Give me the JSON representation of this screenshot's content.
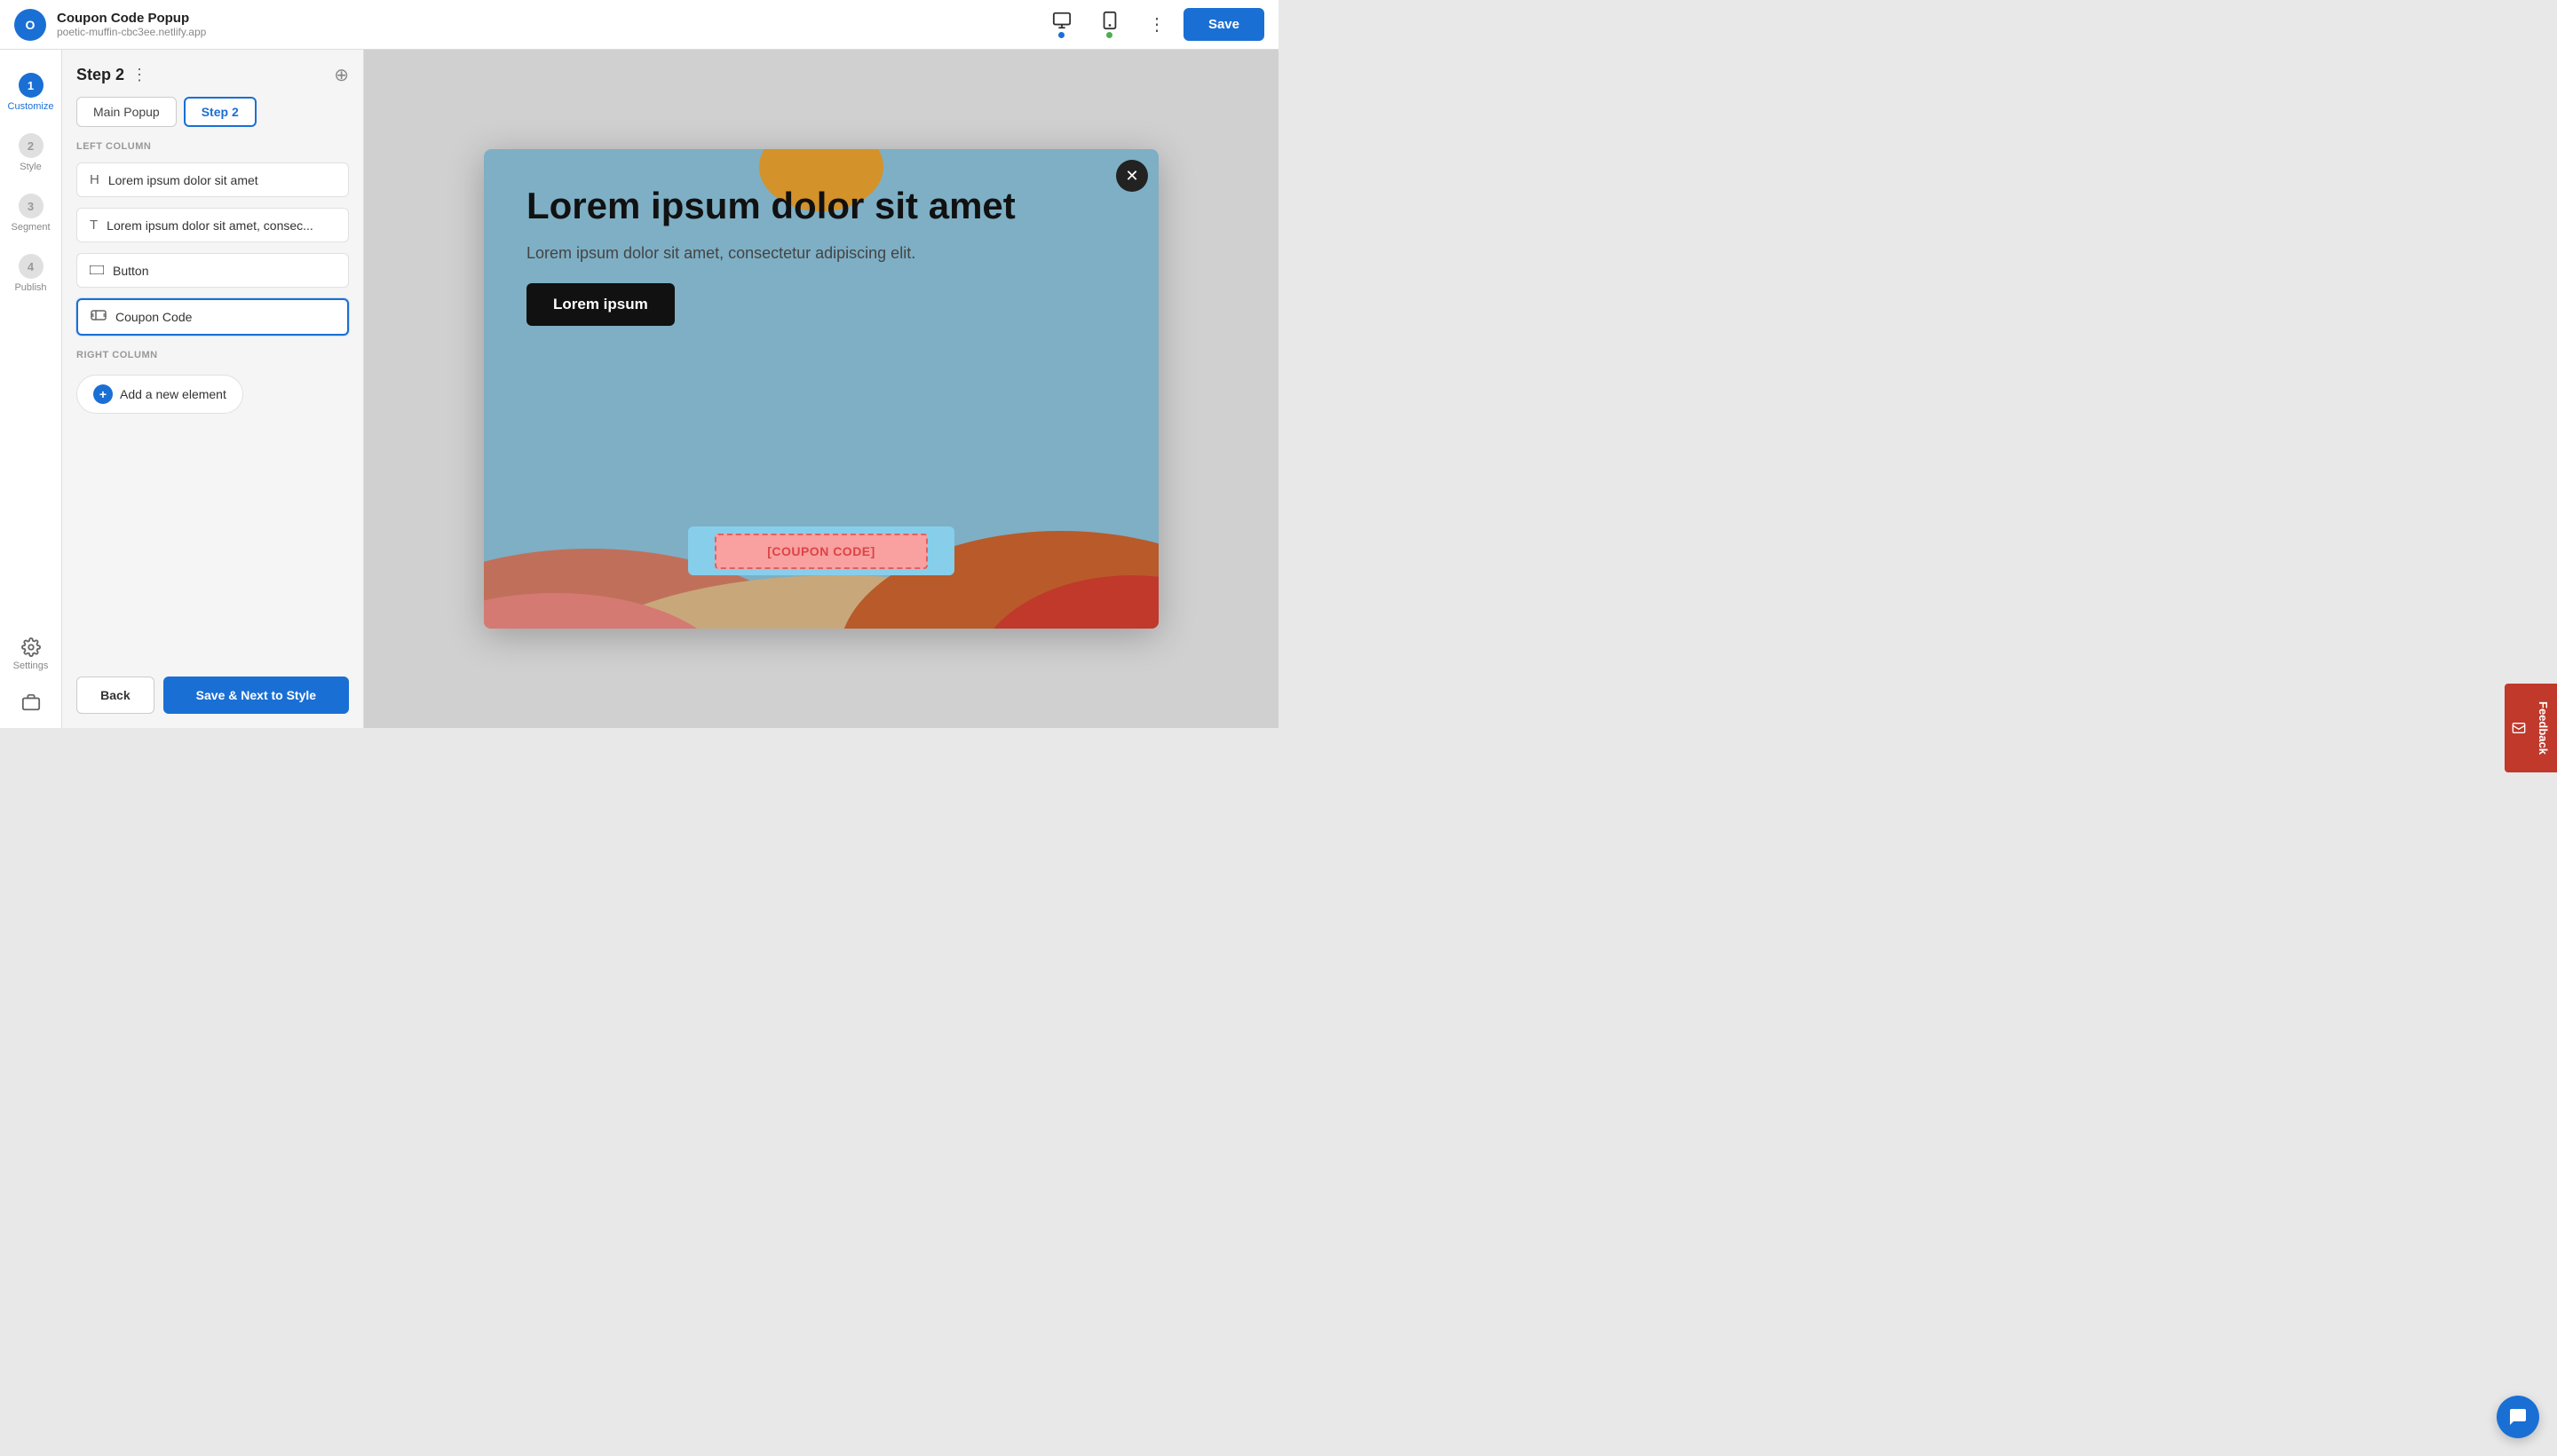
{
  "header": {
    "logo_text": "O",
    "title": "Coupon Code Popup",
    "url": "poetic-muffin-cbc3ee.netlify.app",
    "save_label": "Save",
    "more_label": "⋮"
  },
  "nav": {
    "items": [
      {
        "id": "customize",
        "label": "Customize",
        "number": "1",
        "active": true
      },
      {
        "id": "style",
        "label": "Style",
        "number": "2",
        "active": false
      },
      {
        "id": "segment",
        "label": "Segment",
        "number": "3",
        "active": false
      },
      {
        "id": "publish",
        "label": "Publish",
        "number": "4",
        "active": false
      }
    ],
    "settings_label": "Settings",
    "portfolio_label": ""
  },
  "sidebar": {
    "step_title": "Step 2",
    "tabs": [
      {
        "id": "main-popup",
        "label": "Main Popup",
        "active": false
      },
      {
        "id": "step-2",
        "label": "Step 2",
        "active": true
      }
    ],
    "left_column_label": "LEFT COLUMN",
    "right_column_label": "RIGHT COLUMN",
    "elements": [
      {
        "id": "heading",
        "label": "Lorem ipsum dolor sit amet",
        "icon": "H",
        "selected": false
      },
      {
        "id": "text",
        "label": "Lorem ipsum dolor sit amet, consec...",
        "icon": "T",
        "selected": false
      },
      {
        "id": "button",
        "label": "Button",
        "icon": "▭",
        "selected": false
      },
      {
        "id": "coupon",
        "label": "Coupon Code",
        "icon": "🎟",
        "selected": true
      }
    ],
    "add_element_label": "Add a new element",
    "back_label": "Back",
    "save_next_label": "Save & Next to Style"
  },
  "popup": {
    "heading": "Lorem ipsum dolor sit amet",
    "subtext": "Lorem ipsum dolor sit amet, consectetur adipiscing elit.",
    "cta_label": "Lorem ipsum",
    "coupon_label": "[COUPON CODE]",
    "close_icon": "✕"
  },
  "feedback": {
    "label": "Feedback"
  }
}
